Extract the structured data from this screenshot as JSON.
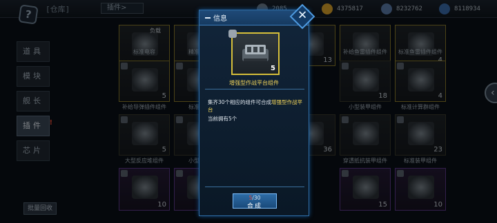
{
  "topbar": {
    "title": "[仓库]",
    "tab": "插件>",
    "currencies": [
      {
        "icon": "fuel-icon",
        "value": "2085",
        "color": "#6e7c8a"
      },
      {
        "icon": "gold-coin-icon",
        "value": "4375817",
        "color": "#d8a02a"
      },
      {
        "icon": "crystal-icon",
        "value": "8232762",
        "color": "#5a7aa8"
      },
      {
        "icon": "credit-icon",
        "value": "8118934",
        "color": "#3a6aa8"
      }
    ]
  },
  "sidemenu": {
    "items": [
      "道具",
      "模块",
      "舰长",
      "插件",
      "芯片"
    ],
    "active_index": 3,
    "batch_button": "批量回收"
  },
  "grid": {
    "labels": {
      "r0c0": "标准电容",
      "r0c1": "精准射弹",
      "r0c4": "补给鱼雷插件组件",
      "r0c5": "标准鱼雷插件组件",
      "r1c0": "补给导弹插件组件",
      "r1c1": "标准导弹",
      "r1c4": "小型装甲组件",
      "r1c5": "标准计算群组件",
      "r2c0": "大型反应堆组件",
      "r2c1": "小型反应",
      "r2c4": "穿透抵抗装甲组件",
      "r2c5": "标准装甲组件"
    },
    "counts": {
      "r0c0_text": "负载",
      "r0c3": "13",
      "r0c5": "4",
      "r1c0": "5",
      "r1c4": "18",
      "r1c5": "4",
      "r2c0": "5",
      "r2c3": "36",
      "r2c5": "23",
      "r3c0": "10",
      "r3c4": "15",
      "r3c5": "10"
    }
  },
  "dialog": {
    "header": "信息",
    "item_name": "增强型作战平台组件",
    "item_count": "5",
    "desc_prefix": "集齐30个相应的组件可合成",
    "desc_highlight": "增强型作战平台",
    "owned_text": "当前拥有5个",
    "progress_current": "5",
    "progress_total": "/30",
    "craft_label": "合成",
    "accent_color": "#f2d55a"
  }
}
